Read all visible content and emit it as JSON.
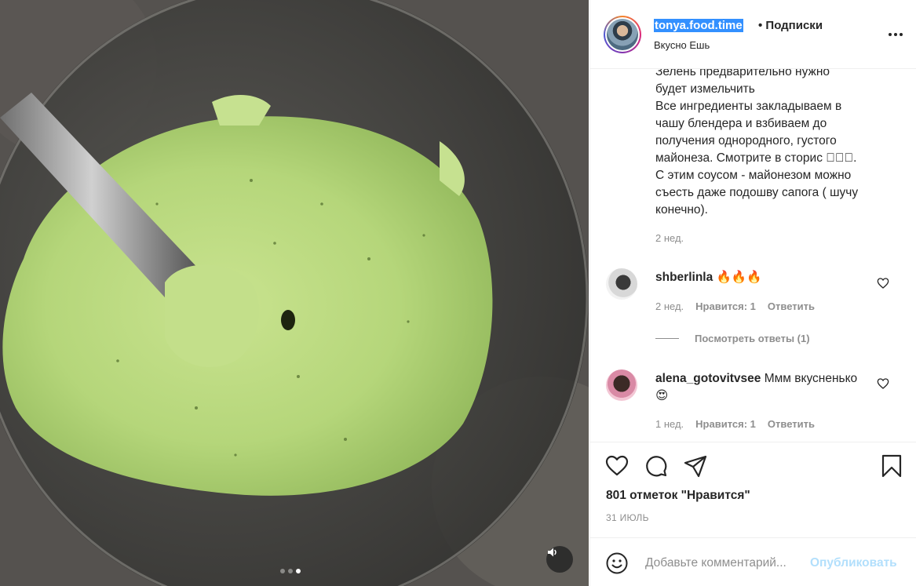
{
  "post": {
    "username": "tonya.food.time",
    "follow_label": "• Подписки",
    "location": "Вкусно Ешь",
    "caption": "Зелень предварительно нужно\nбудет измельчить\nВсе ингредиенты закладываем в\nчашу блендера и взбиваем до\nполучения однородного, густого\nмайонеза. Смотрите в сторис ⃞⃞⃞.\nС этим соусом - майонезом можно\nсъесть даже подошву сапога ( шучу\nконечно).",
    "caption_time": "2 нед."
  },
  "comments": [
    {
      "username": "shberlinla",
      "text": "🔥🔥🔥",
      "time": "2 нед.",
      "likes": "Нравится: 1",
      "reply": "Ответить",
      "view_replies": "Посмотреть ответы (1)"
    },
    {
      "username": "alena_gotovitvsee",
      "text": "Ммм вкусненько 😍",
      "time": "1 нед.",
      "likes": "Нравится: 1",
      "reply": "Ответить"
    }
  ],
  "actions": {
    "icons": [
      "heart-icon",
      "comment-icon",
      "share-icon",
      "bookmark-icon"
    ],
    "likes_count": "801 отметок \"Нравится\"",
    "date": "31 ИЮЛЬ"
  },
  "comment_box": {
    "placeholder": "Добавьте комментарий...",
    "publish_label": "Опубликовать"
  },
  "media": {
    "carousel_total": 3,
    "carousel_active": 3,
    "sound_icon": "speaker-icon"
  },
  "colors": {
    "accent": "#0095f6",
    "publish_disabled": "#b2dffc",
    "secondary_text": "#8e8e8e",
    "text": "#262626",
    "selection": "#3390ff"
  }
}
